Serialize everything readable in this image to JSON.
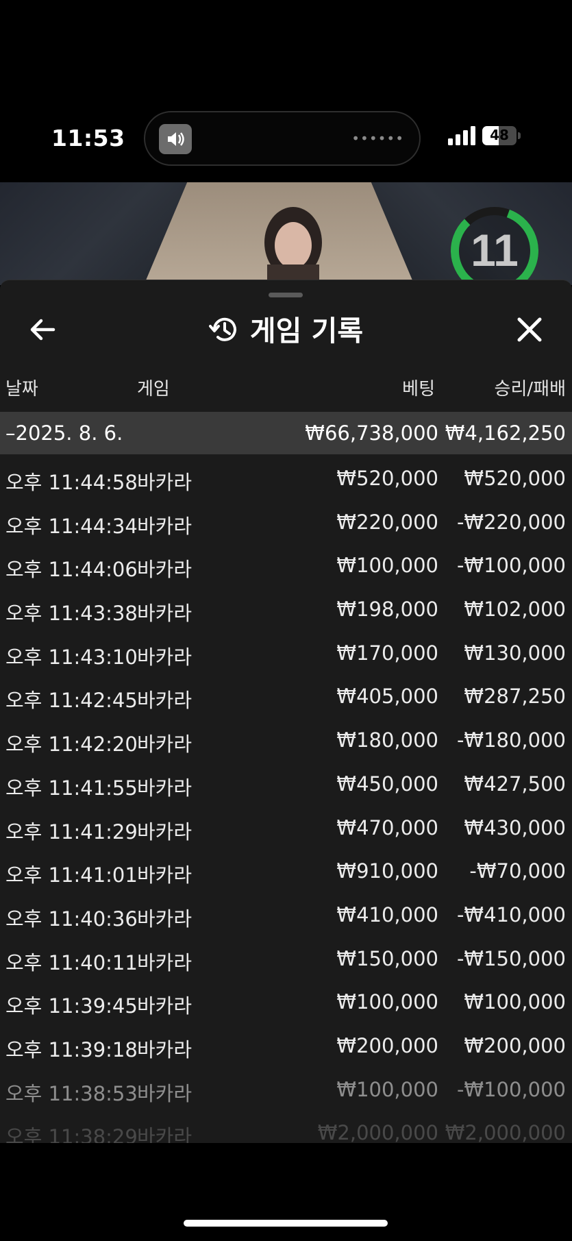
{
  "status_bar": {
    "time": "11:53",
    "battery": "48",
    "battery_level": 0.48,
    "island_icon": "speaker-icon",
    "signal_icon": "cellular-signal-icon"
  },
  "video": {
    "countdown": "11",
    "countdown_color": "#2bb24c"
  },
  "header": {
    "title": "게임 기록",
    "back_icon": "arrow-left-icon",
    "history_icon": "history-icon",
    "close_icon": "close-x-icon"
  },
  "columns": {
    "date": "날짜",
    "game": "게임",
    "bet": "베팅",
    "result": "승리/패배"
  },
  "summary": {
    "date": "–2025. 8. 6.",
    "bet": "₩66,738,000",
    "result": "₩4,162,250"
  },
  "rows": [
    {
      "time": "오후 11:44:58",
      "game": "바카라",
      "bet": "₩520,000",
      "result": "₩520,000"
    },
    {
      "time": "오후 11:44:34",
      "game": "바카라",
      "bet": "₩220,000",
      "result": "-₩220,000"
    },
    {
      "time": "오후 11:44:06",
      "game": "바카라",
      "bet": "₩100,000",
      "result": "-₩100,000"
    },
    {
      "time": "오후 11:43:38",
      "game": "바카라",
      "bet": "₩198,000",
      "result": "₩102,000"
    },
    {
      "time": "오후 11:43:10",
      "game": "바카라",
      "bet": "₩170,000",
      "result": "₩130,000"
    },
    {
      "time": "오후 11:42:45",
      "game": "바카라",
      "bet": "₩405,000",
      "result": "₩287,250"
    },
    {
      "time": "오후 11:42:20",
      "game": "바카라",
      "bet": "₩180,000",
      "result": "-₩180,000"
    },
    {
      "time": "오후 11:41:55",
      "game": "바카라",
      "bet": "₩450,000",
      "result": "₩427,500"
    },
    {
      "time": "오후 11:41:29",
      "game": "바카라",
      "bet": "₩470,000",
      "result": "₩430,000"
    },
    {
      "time": "오후 11:41:01",
      "game": "바카라",
      "bet": "₩910,000",
      "result": "-₩70,000"
    },
    {
      "time": "오후 11:40:36",
      "game": "바카라",
      "bet": "₩410,000",
      "result": "-₩410,000"
    },
    {
      "time": "오후 11:40:11",
      "game": "바카라",
      "bet": "₩150,000",
      "result": "-₩150,000"
    },
    {
      "time": "오후 11:39:45",
      "game": "바카라",
      "bet": "₩100,000",
      "result": "₩100,000"
    },
    {
      "time": "오후 11:39:18",
      "game": "바카라",
      "bet": "₩200,000",
      "result": "₩200,000"
    },
    {
      "time": "오후 11:38:53",
      "game": "바카라",
      "bet": "₩100,000",
      "result": "-₩100,000"
    },
    {
      "time": "오후 11:38:29",
      "game": "바카라",
      "bet": "₩2,000,000",
      "result": "₩2,000,000"
    }
  ]
}
